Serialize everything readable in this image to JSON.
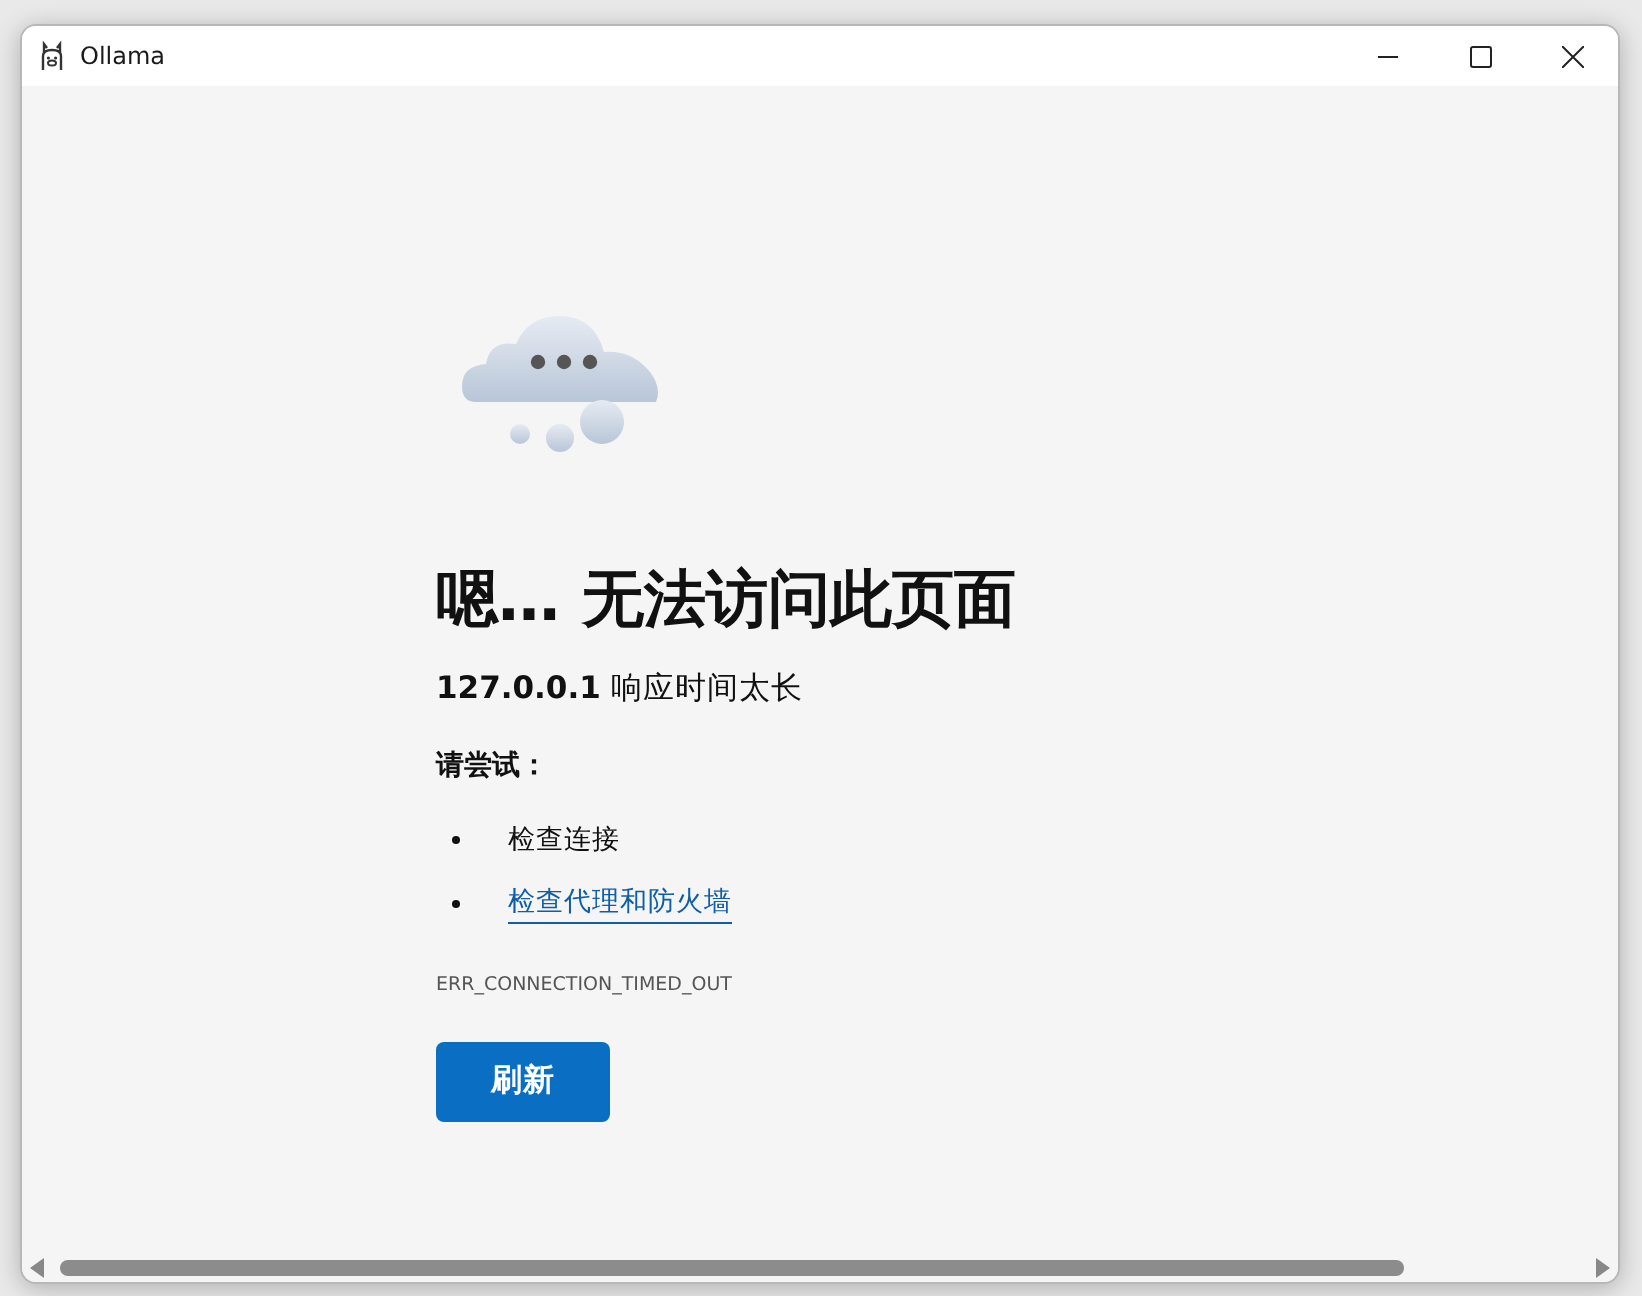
{
  "window": {
    "title": "Ollama"
  },
  "error_page": {
    "heading": "嗯… 无法访问此页面",
    "subtitle": "**127.0.0.1** 响应时间太长",
    "suggestions_label": "请尝试：",
    "suggestions": [
      {
        "text": "检查连接",
        "kind": "text"
      },
      {
        "text": "检查代理和防火墙",
        "kind": "link"
      }
    ],
    "error_code": "ERR_CONNECTION_TIMED_OUT",
    "button": "刷新"
  }
}
